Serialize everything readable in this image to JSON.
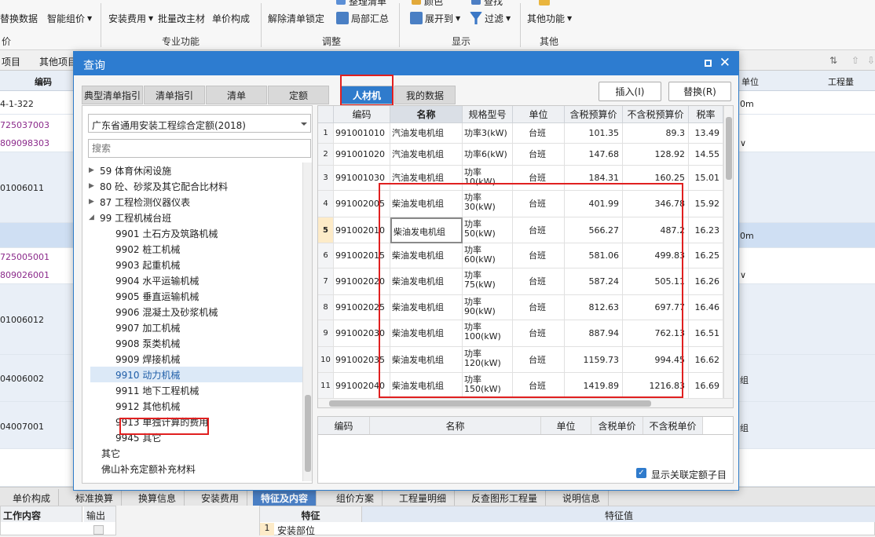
{
  "ribbon": {
    "top_labels": [
      "整理清单",
      "颜色",
      "查找"
    ],
    "buttons": {
      "replace_data": "替换数据",
      "smart_price": "智能组价",
      "install_fee": "安装费用",
      "batch_main": "批量改主材",
      "unit_price": "单价构成",
      "unlock": "解除清单锁定",
      "partial_sum": "局部汇总",
      "expand": "展开到",
      "filter": "过滤",
      "other_func": "其他功能"
    },
    "groups": {
      "left_partial": "价",
      "pro": "专业功能",
      "adjust": "调整",
      "display": "显示",
      "other": "其他"
    }
  },
  "background": {
    "tabs": [
      "项目",
      "其他项目"
    ],
    "col_code": "编码",
    "col_unit": "单位",
    "col_qty": "工程量",
    "codes": [
      "4-1-322",
      "725037003",
      "809098303",
      "01006011",
      "725005001",
      "809026001",
      "01006012",
      "04006002",
      "04007001"
    ],
    "right_texts": [
      "0m",
      "0m"
    ],
    "right_texts_extra": [
      "∨",
      "∨",
      "组",
      "组"
    ]
  },
  "bottom": {
    "tabs": [
      "单价构成",
      "标准换算",
      "换算信息",
      "安装费用",
      "特征及内容",
      "组价方案",
      "工程量明细",
      "反查图形工程量",
      "说明信息"
    ],
    "active_tab": "特征及内容",
    "panel_left_h1": "工作内容",
    "panel_left_h2": "输出",
    "feature_h": "特征",
    "feature_val_h": "特征值",
    "row1_num": "1",
    "row1_text": "安装部位"
  },
  "dialog": {
    "title": "查询",
    "tabs": [
      "典型清单指引",
      "清单指引",
      "清单",
      "定额",
      "人材机",
      "我的数据"
    ],
    "active_tab": "人材机",
    "insert_label": "插入(I)",
    "replace_label": "替换(R)",
    "library": "广东省通用安装工程综合定额(2018)",
    "search_placeholder": "搜索",
    "tree": [
      {
        "label": "59 体育休闲设施",
        "level": 0,
        "arrow": "▶"
      },
      {
        "label": "80 砼、砂浆及其它配合比材料",
        "level": 0,
        "arrow": "▶"
      },
      {
        "label": "87 工程检测仪器仪表",
        "level": 0,
        "arrow": "▶"
      },
      {
        "label": "99 工程机械台班",
        "level": 0,
        "arrow": "◢"
      },
      {
        "label": "9901 土石方及筑路机械",
        "level": 1
      },
      {
        "label": "9902 桩工机械",
        "level": 1
      },
      {
        "label": "9903 起重机械",
        "level": 1
      },
      {
        "label": "9904 水平运输机械",
        "level": 1
      },
      {
        "label": "9905 垂直运输机械",
        "level": 1
      },
      {
        "label": "9906 混凝土及砂浆机械",
        "level": 1
      },
      {
        "label": "9907 加工机械",
        "level": 1
      },
      {
        "label": "9908 泵类机械",
        "level": 1
      },
      {
        "label": "9909 焊接机械",
        "level": 1
      },
      {
        "label": "9910 动力机械",
        "level": 1,
        "selected": true
      },
      {
        "label": "9911 地下工程机械",
        "level": 1
      },
      {
        "label": "9912 其他机械",
        "level": 1
      },
      {
        "label": "9913 单独计算的费用",
        "level": 1
      },
      {
        "label": "9945 其它",
        "level": 1
      },
      {
        "label": "其它",
        "level": -1
      },
      {
        "label": "佛山补充定额补充材料",
        "level": -1
      }
    ],
    "table": {
      "headers": [
        "编码",
        "名称",
        "规格型号",
        "单位",
        "含税预算价",
        "不含税预算价",
        "税率"
      ],
      "rows": [
        {
          "n": "1",
          "code": "991001010",
          "name": "汽油发电机组",
          "spec1": "功率3(kW)",
          "spec2": "",
          "unit": "台班",
          "p1": "101.35",
          "p2": "89.3",
          "tax": "13.49"
        },
        {
          "n": "2",
          "code": "991001020",
          "name": "汽油发电机组",
          "spec1": "功率6(kW)",
          "spec2": "",
          "unit": "台班",
          "p1": "147.68",
          "p2": "128.92",
          "tax": "14.55"
        },
        {
          "n": "3",
          "code": "991001030",
          "name": "汽油发电机组",
          "spec1": "功率",
          "spec2": "10(kW)",
          "unit": "台班",
          "p1": "184.31",
          "p2": "160.25",
          "tax": "15.01"
        },
        {
          "n": "4",
          "code": "991002005",
          "name": "柴油发电机组",
          "spec1": "功率",
          "spec2": "30(kW)",
          "unit": "台班",
          "p1": "401.99",
          "p2": "346.78",
          "tax": "15.92"
        },
        {
          "n": "5",
          "code": "991002010",
          "name": "柴油发电机组",
          "spec1": "功率",
          "spec2": "50(kW)",
          "unit": "台班",
          "p1": "566.27",
          "p2": "487.2",
          "tax": "16.23"
        },
        {
          "n": "6",
          "code": "991002015",
          "name": "柴油发电机组",
          "spec1": "功率",
          "spec2": "60(kW)",
          "unit": "台班",
          "p1": "581.06",
          "p2": "499.83",
          "tax": "16.25"
        },
        {
          "n": "7",
          "code": "991002020",
          "name": "柴油发电机组",
          "spec1": "功率",
          "spec2": "75(kW)",
          "unit": "台班",
          "p1": "587.24",
          "p2": "505.11",
          "tax": "16.26"
        },
        {
          "n": "8",
          "code": "991002025",
          "name": "柴油发电机组",
          "spec1": "功率",
          "spec2": "90(kW)",
          "unit": "台班",
          "p1": "812.63",
          "p2": "697.77",
          "tax": "16.46"
        },
        {
          "n": "9",
          "code": "991002030",
          "name": "柴油发电机组",
          "spec1": "功率",
          "spec2": "100(kW)",
          "unit": "台班",
          "p1": "887.94",
          "p2": "762.13",
          "tax": "16.51"
        },
        {
          "n": "10",
          "code": "991002035",
          "name": "柴油发电机组",
          "spec1": "功率",
          "spec2": "120(kW)",
          "unit": "台班",
          "p1": "1159.73",
          "p2": "994.45",
          "tax": "16.62"
        },
        {
          "n": "11",
          "code": "991002040",
          "name": "柴油发电机组",
          "spec1": "功率",
          "spec2": "150(kW)",
          "unit": "台班",
          "p1": "1419.89",
          "p2": "1216.83",
          "tax": "16.69"
        }
      ]
    },
    "lower_headers": [
      "编码",
      "名称",
      "单位",
      "含税单价",
      "不含税单价"
    ],
    "show_related": "显示关联定额子目"
  },
  "colors": {
    "accent": "#2d7cd0",
    "highlight_box": "#e02020",
    "purple_code": "#8b2a8b"
  }
}
